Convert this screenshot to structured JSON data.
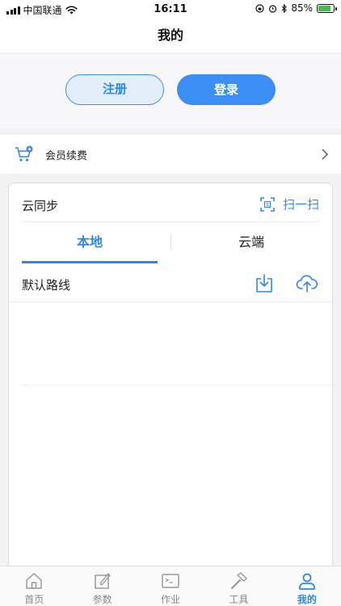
{
  "status_bar": {
    "carrier": "中国联通",
    "time": "16:11",
    "battery": "85%",
    "battery_level": 0.85
  },
  "nav": {
    "title": "我的"
  },
  "auth": {
    "register_label": "注册",
    "login_label": "登录"
  },
  "member": {
    "label": "会员续费",
    "icon": "cart-plus-icon"
  },
  "sync": {
    "title": "云同步",
    "scan_label": "扫一扫",
    "tabs": [
      {
        "label": "本地",
        "active": true
      },
      {
        "label": "云端",
        "active": false
      }
    ],
    "routes": [
      {
        "name": "默认路线"
      }
    ]
  },
  "tab_bar": [
    {
      "label": "首页",
      "icon": "home-icon",
      "active": false
    },
    {
      "label": "参数",
      "icon": "edit-icon",
      "active": false
    },
    {
      "label": "作业",
      "icon": "terminal-icon",
      "active": false
    },
    {
      "label": "工具",
      "icon": "hammer-icon",
      "active": false
    },
    {
      "label": "我的",
      "icon": "user-icon",
      "active": true
    }
  ],
  "colors": {
    "accent": "#2f86ee",
    "login_bg": "#3b8ff4",
    "register_bg": "#e3eefb",
    "battery_fill": "#3fbd4e"
  }
}
